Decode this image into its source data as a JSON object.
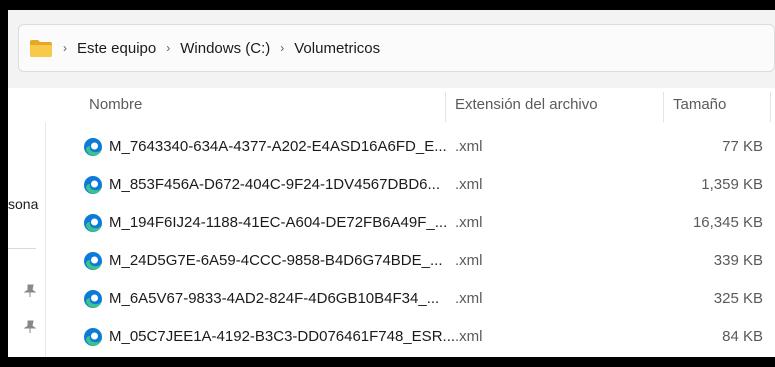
{
  "breadcrumb": {
    "folder_icon": "folder-icon",
    "items": [
      "Este equipo",
      "Windows (C:)",
      "Volumetricos"
    ],
    "separator": "›"
  },
  "left_pane": {
    "partial_label": "sona",
    "pin_icon": "pin-icon"
  },
  "columns": {
    "name": "Nombre",
    "extension": "Extensión del archivo",
    "size": "Tamaño"
  },
  "files": [
    {
      "name": "M_7643340-634A-4377-A202-E4ASD16A6FD_E...",
      "extension": ".xml",
      "size": "77 KB"
    },
    {
      "name": "M_853F456A-D672-404C-9F24-1DV4567DBD6...",
      "extension": ".xml",
      "size": "1,359 KB"
    },
    {
      "name": "M_194F6IJ24-1188-41EC-A604-DE72FB6A49F_...",
      "extension": ".xml",
      "size": "16,345 KB"
    },
    {
      "name": "M_24D5G7E-6A59-4CCC-9858-B4D6G74BDE_...",
      "extension": ".xml",
      "size": "339 KB"
    },
    {
      "name": "M_6A5V67-9833-4AD2-824F-4D6GB10B4F34_...",
      "extension": ".xml",
      "size": "325 KB"
    },
    {
      "name": "M_05C7JEE1A-4192-B3C3-DD076461F748_ESR...",
      "extension": ".xml",
      "size": "84 KB"
    }
  ],
  "file_icon": "edge-icon",
  "colors": {
    "edge_blue": "#0c7bd8",
    "edge_green": "#3cc28a",
    "folder_yellow": "#f4c542"
  }
}
